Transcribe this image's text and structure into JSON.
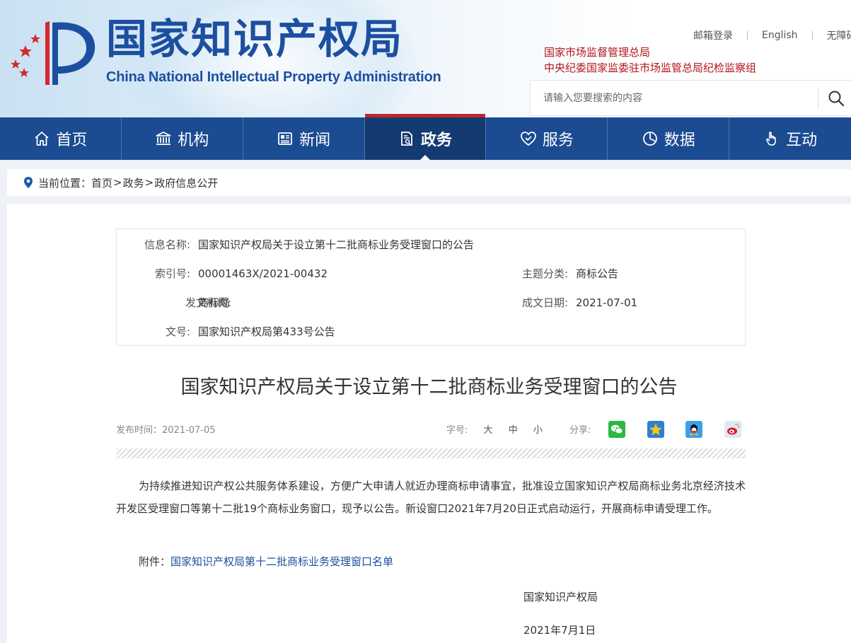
{
  "header": {
    "logo_cn": "国家知识产权局",
    "logo_en": "China National Intellectual Property Administration",
    "top_links": [
      "邮箱登录",
      "English",
      "无障碍"
    ],
    "org_links": [
      "国家市场监督管理总局",
      "中央纪委国家监委驻市场监管总局纪检监察组"
    ],
    "search_placeholder": "请输入您要搜索的内容"
  },
  "nav": {
    "items": [
      {
        "label": "首页",
        "icon": "home-icon"
      },
      {
        "label": "机构",
        "icon": "institution-icon"
      },
      {
        "label": "新闻",
        "icon": "news-icon"
      },
      {
        "label": "政务",
        "icon": "government-affairs-icon",
        "active": true
      },
      {
        "label": "服务",
        "icon": "service-icon"
      },
      {
        "label": "数据",
        "icon": "data-icon"
      },
      {
        "label": "互动",
        "icon": "interaction-icon"
      }
    ]
  },
  "breadcrumb": {
    "prefix": "当前位置：",
    "items": [
      "首页",
      "政务",
      "政府信息公开"
    ],
    "sep": ">"
  },
  "info": {
    "name_label": "信息名称:",
    "name_value": "国家知识产权局关于设立第十二批商标业务受理窗口的公告",
    "index_label": "索引号:",
    "index_value": "00001463X/2021-00432",
    "topic_label": "主题分类:",
    "topic_value": "商标公告",
    "issuer_label": "发文机构:",
    "issuer_value": "商标局",
    "date_label": "成文日期:",
    "date_value": "2021-07-01",
    "doc_no_label": "文号:",
    "doc_no_value": "国家知识产权局第433号公告"
  },
  "article": {
    "title": "国家知识产权局关于设立第十二批商标业务受理窗口的公告",
    "publish": "发布时间：2021-07-05",
    "font_size_label": "字号:",
    "font_sizes": [
      "大",
      "中",
      "小"
    ],
    "share_label": "分享:",
    "share_icons": [
      "wechat-icon",
      "qzone-icon",
      "qq-icon",
      "weibo-icon"
    ],
    "body": "为持续推进知识产权公共服务体系建设，方便广大申请人就近办理商标申请事宜，批准设立国家知识产权局商标业务北京经济技术开发区受理窗口等第十二批19个商标业务窗口，现予以公告。新设窗口2021年7月20日正式启动运行，开展商标申请受理工作。",
    "attach_label": "附件：",
    "attach_link": "国家知识产权局第十二批商标业务受理窗口名单",
    "sign_org": "国家知识产权局",
    "sign_date": "2021年7月1日"
  },
  "colors": {
    "nav_bg": "#1b4b91",
    "nav_active_bg": "#143a72",
    "accent_red": "#c0272d",
    "link_blue": "#1d4fa0"
  }
}
